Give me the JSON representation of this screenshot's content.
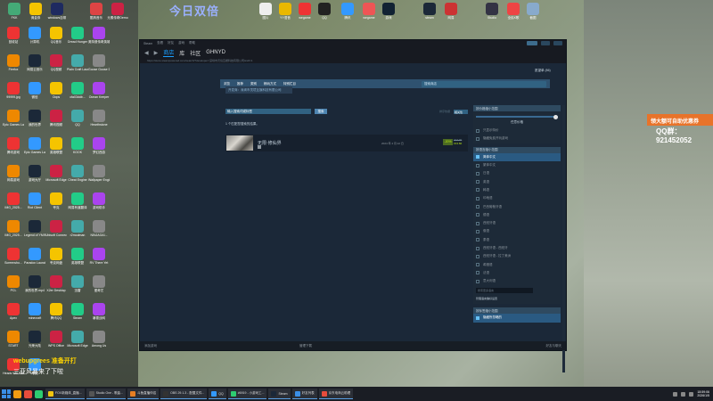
{
  "desktop": {
    "banner": "今日双倍",
    "top_icons": [
      "FKK",
      "佣金券",
      "windows自带",
      "酷狗音乐",
      "元素传奇Demo",
      "图片",
      "YY语音",
      "wegame",
      "QQ",
      "腾讯",
      "wegame",
      "游戏",
      "steam",
      "网易",
      "Studio",
      "全民K歌",
      "截图"
    ],
    "left_icons": [
      "回收站",
      "计算机",
      "QQ音乐",
      "Dread Hunger",
      "奥特曼传奇英雄",
      "Firefox",
      "网易云音乐",
      "QQ视频",
      "Plain Craft Launcher",
      "Goose Goose Duck",
      "99999.jpg",
      "微信",
      "Oops",
      "cfa03ddb...",
      "Ocean Keeper",
      "Epic Games Launcher",
      "我的世界",
      "腾讯视频",
      "QQ",
      "Hearthstone",
      "腾讯游戏",
      "Epic Games Launcher",
      "英雄联盟",
      "KOOK",
      "梦幻西游",
      "网易游戏",
      "游戏大厅",
      "Microsoft Edge",
      "Cheat Engine",
      "Wallpaper Engine",
      "IMG_2025...",
      "Riot Client",
      "夸克",
      "网易有道翻译",
      "游戏助手",
      "IMG_2025...",
      "Legend of YMIR",
      "Ubisoft Connect",
      "r2modman",
      "NINJAGAI...",
      "Screensho...",
      "Paradox Launcher v2",
      "夸克网盘",
      "英雄联盟",
      "RV There Yet",
      "PCL",
      "我的世界.mp4",
      "X2er Desktop",
      "迅雷",
      "爱奇艺",
      "Apex",
      "minecraft",
      "腾讯QQ",
      "Steam",
      "暴雪战网",
      "START",
      "光荣大陆",
      "WPS Office",
      "Microsoft Edge",
      "Among Us",
      "Heads Will Roll",
      "夸克"
    ],
    "ad_text": "领大额可自助优惠券",
    "qq_text": "QQ群：921452052",
    "live_line1": "webupgrees 准备开打",
    "live_line2": "三亚风暴来了下啦"
  },
  "steam": {
    "title_menu": [
      "Steam",
      "查看",
      "好友",
      "游戏",
      "帮助"
    ],
    "nav_tabs": [
      "商店",
      "库",
      "社区",
      "GHNYD"
    ],
    "url": "https://store.steampowered.com/search/?developer=深圳市灵境互娱科技有限公司&ndl=1",
    "store_nav": [
      "浏览",
      "推荐",
      "类别",
      "畅玩方式",
      "特别栏目"
    ],
    "store_search_placeholder": "搜索商店",
    "wishlist": "愿望单 (86)",
    "publisher_tag": "开发商：深圳市灵境互娱科技有限公司",
    "search_input": "输入搜索词或标签",
    "search_button": "搜索",
    "sort_label": "排序依据",
    "sort_value": "相关性",
    "results_count": "1 个匹配您搜索的结果。",
    "result": {
      "title": "无限·修仙界",
      "date": "2024 年 4 月 22 日",
      "discount": "-20%",
      "old_price": "¥17.00",
      "new_price": "¥13.60"
    },
    "price_filter": {
      "header": "按价格缩小范围",
      "value": "任意价格",
      "checks": [
        "只显示特价",
        "隐藏免费开玩游戏"
      ]
    },
    "prefs_filter": {
      "header": "按偏好缩小范围",
      "items": [
        {
          "label": "隐藏所忽略的",
          "selected": true
        },
        {
          "label": "隐藏我拥有的",
          "selected": false
        },
        {
          "label": "隐藏愿望单内的",
          "selected": false
        }
      ]
    },
    "lang_filter": {
      "header": "按语言缩小范围",
      "items": [
        {
          "label": "简体中文",
          "selected": true
        },
        {
          "label": "繁体中文",
          "selected": false
        },
        {
          "label": "日语",
          "selected": false
        },
        {
          "label": "英语",
          "selected": false
        },
        {
          "label": "韩语",
          "selected": false
        },
        {
          "label": "印地语",
          "selected": false
        },
        {
          "label": "巴西葡萄牙语",
          "selected": false
        },
        {
          "label": "德语",
          "selected": false
        },
        {
          "label": "西班牙语",
          "selected": false
        },
        {
          "label": "俄语",
          "selected": false
        },
        {
          "label": "泰语",
          "selected": false
        },
        {
          "label": "西班牙语 - 西班牙",
          "selected": false
        },
        {
          "label": "西班牙语 - 拉丁美洲",
          "selected": false
        },
        {
          "label": "希腊语",
          "selected": false
        },
        {
          "label": "法语",
          "selected": false
        },
        {
          "label": "意大利语",
          "selected": false
        }
      ],
      "filter_placeholder": "搜索更多语言",
      "more_link": "管理语言偏好设置"
    },
    "tag_filter_header": "按标签缩小范围",
    "tag_first": "隐藏所忽略的",
    "footer_left": "添加游戏",
    "footer_mid": "管理下载",
    "footer_right": "好友与聊天"
  },
  "taskbar": {
    "apps": [
      "FOX新媒体_直播...",
      "Studio One - 歌曲...",
      "斗鱼直播伴侣",
      "OBS 29.1.3 - 配置文件...",
      "QQ",
      "#6919 - 小游戏工...",
      "Steam",
      "好友列表",
      "京东电商云助理"
    ],
    "time": "18:59:06",
    "date": "2026/1/5"
  },
  "colors": {
    "steam_bg": "#1b2838",
    "steam_accent": "#1a9fff",
    "discount_green": "#4c6b22",
    "price_green": "#beee11"
  }
}
